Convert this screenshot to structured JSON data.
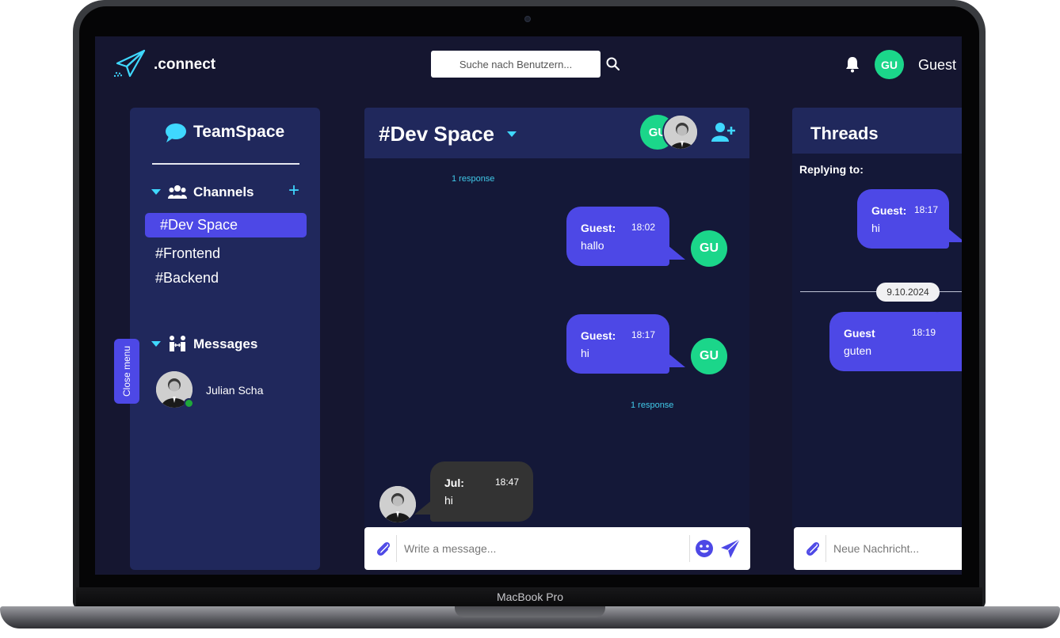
{
  "device": {
    "label": "MacBook Pro"
  },
  "topbar": {
    "brand": ".connect",
    "search_placeholder": "Suche nach Benutzern...",
    "avatar_initials": "GU",
    "user_name": "Guest",
    "icons": [
      "paper-plane-icon",
      "search-icon",
      "bell-icon"
    ]
  },
  "sidebar": {
    "title": "TeamSpace",
    "channels_label": "Channels",
    "add_label": "+",
    "channels": [
      "#Dev Space",
      "#Frontend",
      "#Backend"
    ],
    "active_channel": "#Dev Space",
    "messages_label": "Messages",
    "direct_messages": [
      {
        "name": "Julian Scha",
        "status": "online"
      }
    ],
    "close_menu": "Close menu"
  },
  "channel": {
    "title": "#Dev Space",
    "member_initials": "GU",
    "input_placeholder": "Write a message...",
    "messages": [
      {
        "response": "1 response"
      },
      {
        "sender": "Guest:",
        "time": "18:02",
        "text": "hallo",
        "avatar": "GU"
      },
      {
        "sender": "Guest:",
        "time": "18:17",
        "text": "hi",
        "avatar": "GU",
        "response": "1 response"
      },
      {
        "sender": "Jul:",
        "time": "18:47",
        "text": "hi"
      }
    ]
  },
  "threads": {
    "title": "Threads",
    "replying_label": "Replying to:",
    "original": {
      "sender": "Guest:",
      "time": "18:17",
      "text": "hi"
    },
    "date_separator": "9.10.2024",
    "reply": {
      "sender": "Guest",
      "time": "18:19",
      "text": "guten"
    },
    "input_placeholder": "Neue Nachricht..."
  },
  "colors": {
    "background": "#151630",
    "panel": "#20285c",
    "accent": "#4d48e6",
    "cyan": "#3fd8ff",
    "avatar_green": "#1bd68a"
  }
}
